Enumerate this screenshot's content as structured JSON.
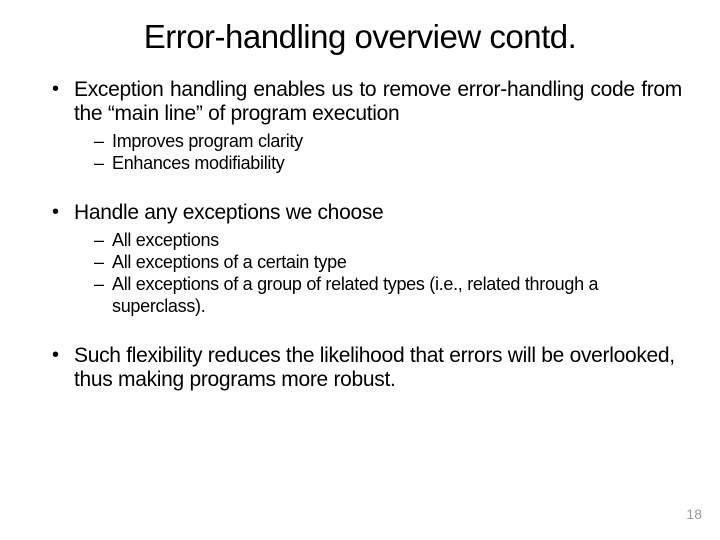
{
  "title": "Error-handling overview contd.",
  "bullets": {
    "b1": {
      "text": "Exception handling enables us to remove error-handling code from the “main line” of program execution",
      "sub": {
        "s1": "Improves program clarity",
        "s2": "Enhances modifiability"
      }
    },
    "b2": {
      "text": "Handle any exceptions we choose",
      "sub": {
        "s1": "All exceptions",
        "s2": "All exceptions of a certain type",
        "s3": "All exceptions of a group of related types (i.e., related through a superclass)."
      }
    },
    "b3": {
      "text": "Such flexibility reduces the likelihood that errors will be overlooked, thus making programs more robust."
    }
  },
  "page_number": "18"
}
